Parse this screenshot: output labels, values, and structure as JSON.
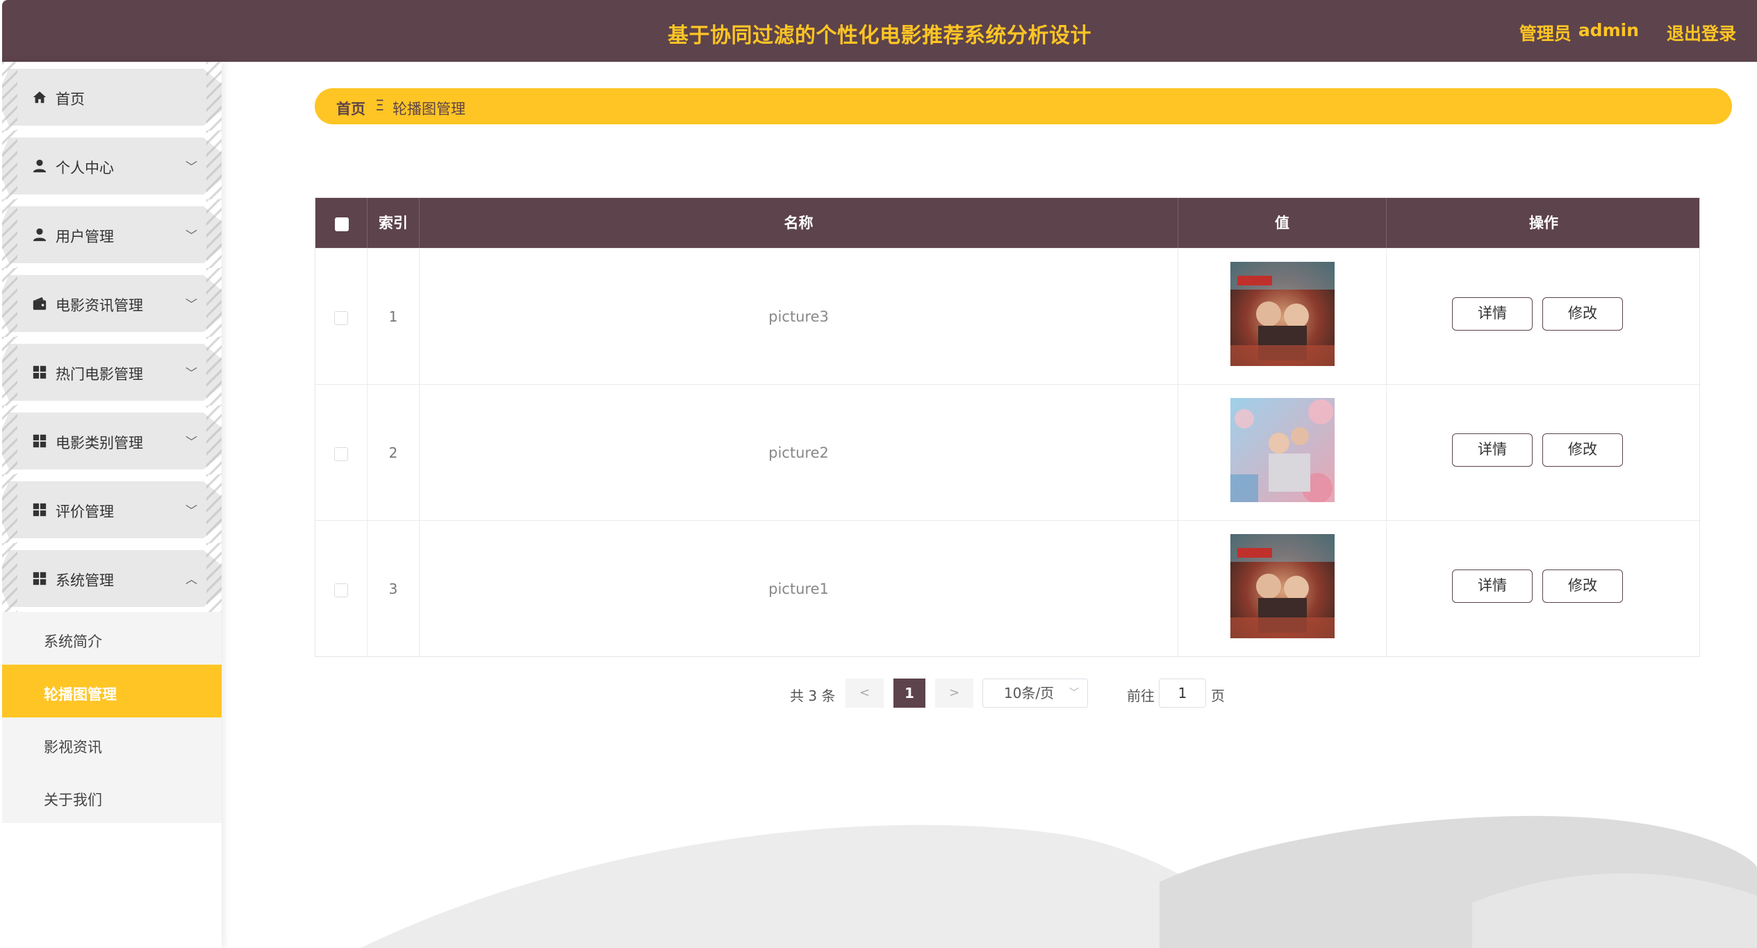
{
  "header": {
    "title": "基于协同过滤的个性化电影推荐系统分析设计",
    "admin_role": "管理员",
    "admin_name": "admin",
    "logout": "退出登录"
  },
  "sidebar": {
    "items": [
      {
        "label": "首页",
        "icon": "home-icon",
        "expandable": false
      },
      {
        "label": "个人中心",
        "icon": "user-icon",
        "expandable": true
      },
      {
        "label": "用户管理",
        "icon": "user-icon",
        "expandable": true
      },
      {
        "label": "电影资讯管理",
        "icon": "wallet-icon",
        "expandable": true
      },
      {
        "label": "热门电影管理",
        "icon": "grid-icon",
        "expandable": true
      },
      {
        "label": "电影类别管理",
        "icon": "grid-icon",
        "expandable": true
      },
      {
        "label": "评价管理",
        "icon": "grid-icon",
        "expandable": true
      },
      {
        "label": "系统管理",
        "icon": "grid-icon",
        "expandable": true,
        "expanded": true
      }
    ],
    "sub_items": [
      {
        "label": "系统简介",
        "active": false
      },
      {
        "label": "轮播图管理",
        "active": true
      },
      {
        "label": "影视资讯",
        "active": false
      },
      {
        "label": "关于我们",
        "active": false
      }
    ]
  },
  "breadcrumb": {
    "home": "首页",
    "separator": "Ξ",
    "current": "轮播图管理"
  },
  "table": {
    "columns": [
      "索引",
      "名称",
      "值",
      "操作"
    ],
    "rows": [
      {
        "index": "1",
        "name": "picture3",
        "image": "movie-poster-street"
      },
      {
        "index": "2",
        "name": "picture2",
        "image": "movie-poster-blossom"
      },
      {
        "index": "3",
        "name": "picture1",
        "image": "movie-poster-street"
      }
    ],
    "actions": {
      "detail": "详情",
      "edit": "修改"
    }
  },
  "pagination": {
    "total": "共 3 条",
    "prev": "<",
    "current_page": "1",
    "next": ">",
    "page_size": "10条/页",
    "goto_label": "前往",
    "goto_value": "1",
    "goto_suffix": "页"
  },
  "colors": {
    "primary": "#5d434b",
    "accent": "#ffc524"
  }
}
